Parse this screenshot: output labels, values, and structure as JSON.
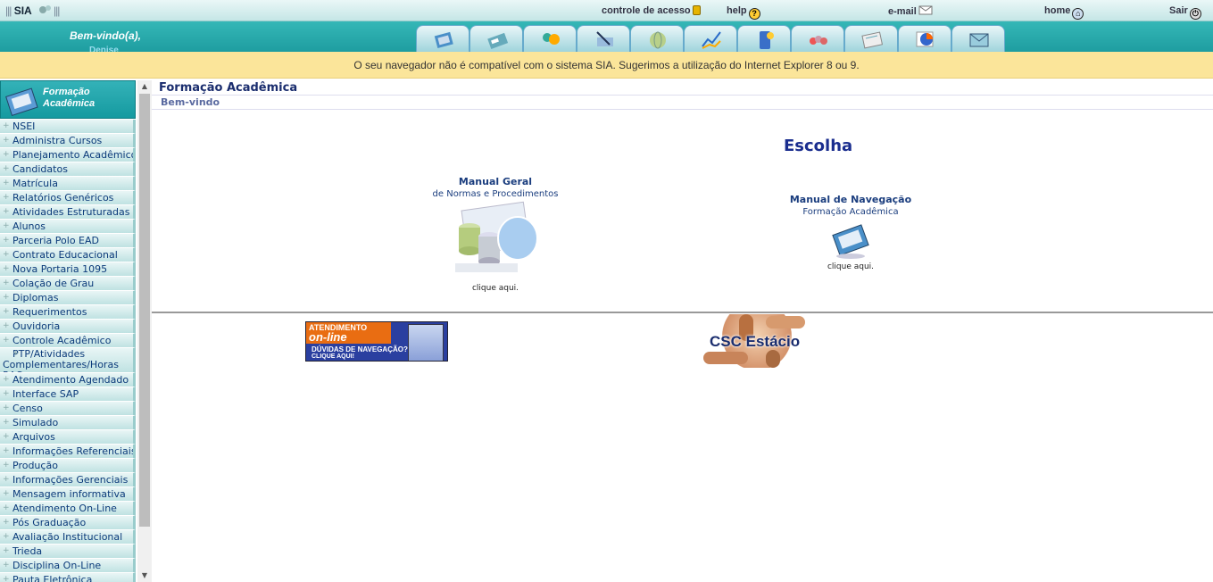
{
  "topbar": {
    "app_name": "SIA",
    "links": {
      "controle": "controle de acesso",
      "help": "help",
      "email": "e-mail",
      "home": "home",
      "sair": "Sair"
    }
  },
  "header": {
    "welcome": "Bem-vindo(a),",
    "user_name": "Denise",
    "nav_icons": [
      "academic-icon",
      "card-icon",
      "people-icon",
      "pen-icon",
      "globe-icon",
      "chart-icon",
      "phone-icon",
      "group-icon",
      "certificate-icon",
      "pie-icon",
      "envelope-icon"
    ]
  },
  "warning": {
    "text": "O seu navegador não é compatível com o sistema SIA. Sugerimos a utilização do Internet Explorer 8 ou 9."
  },
  "sidebar": {
    "title_line1": "Formação",
    "title_line2": "Acadêmica",
    "items": [
      "NSEI",
      "Administra Cursos",
      "Planejamento Acadêmico",
      "Candidatos",
      "Matrícula",
      "Relatórios Genéricos",
      "Atividades Estruturadas",
      "Alunos",
      "Parceria Polo EAD",
      "Contrato Educacional",
      "Nova Portaria 1095",
      "Colação de Grau",
      "Diplomas",
      "Requerimentos",
      "Ouvidoria",
      "Controle Acadêmico",
      "PTP/Atividades Complementares/Horas RAC",
      "Atendimento Agendado",
      "Interface SAP",
      "Censo",
      "Simulado",
      "Arquivos",
      "Informações Referenciais",
      "Produção",
      "Informações Gerenciais",
      "Mensagem informativa",
      "Atendimento On-Line",
      "Pós Graduação",
      "Avaliação Institucional",
      "Trieda",
      "Disciplina On-Line",
      "Pauta Eletrônica"
    ]
  },
  "main": {
    "breadcrumb_title": "Formação Acadêmica",
    "breadcrumb_sub": "Bem-vindo",
    "heading": "Escolha",
    "manual_geral": {
      "title": "Manual Geral",
      "subtitle": "de Normas e Procedimentos",
      "click": "clique aqui."
    },
    "manual_nav": {
      "title": "Manual de Navegação",
      "subtitle": "Formação Acadêmica",
      "click": "clique aqui."
    },
    "banner_atendimento": {
      "line1": "ATENDIMENTO",
      "line2": "on-line",
      "line3": "DÚVIDAS DE NAVEGAÇÃO?",
      "line4": "CLIQUE AQUI!"
    },
    "banner_csc": "CSC Estácio"
  }
}
